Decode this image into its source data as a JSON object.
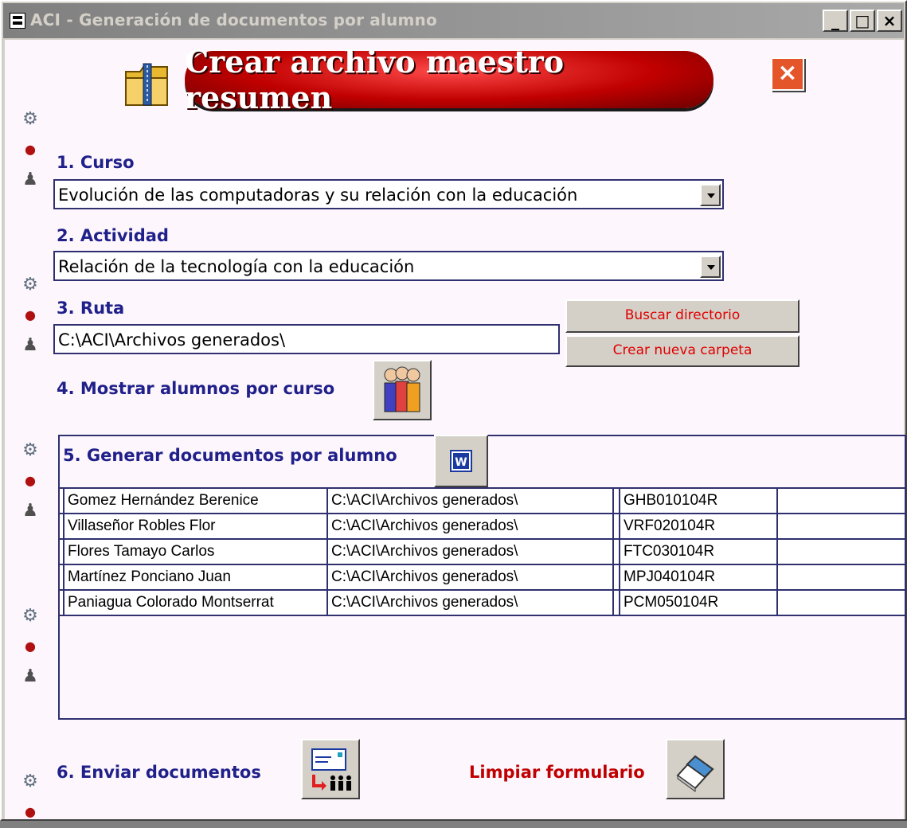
{
  "window": {
    "title": "ACI - Generación de documentos por alumno",
    "minimize": "_",
    "maximize": "□",
    "close": "×"
  },
  "header": {
    "banner_text": "Crear archivo maestro resumen",
    "close_glyph": "×"
  },
  "steps": {
    "curso_label": "1. Curso",
    "curso_value": "Evolución de las computadoras y su relación con la educación",
    "actividad_label": "2. Actividad",
    "actividad_value": "Relación de la tecnología con la educación",
    "ruta_label": "3. Ruta",
    "ruta_value": "C:\\ACI\\Archivos generados\\",
    "buscar_button": "Buscar directorio",
    "crear_button": "Crear nueva carpeta",
    "mostrar_label": "4. Mostrar alumnos por curso",
    "generar_label": "5. Generar documentos por alumno",
    "enviar_label": "6. Enviar documentos",
    "limpiar_label": "Limpiar formulario"
  },
  "students": [
    {
      "name": "Gomez Hernández Berenice",
      "path": "C:\\ACI\\Archivos generados\\",
      "code": "GHB010104R",
      "extra": ""
    },
    {
      "name": "Villaseñor Robles Flor",
      "path": "C:\\ACI\\Archivos generados\\",
      "code": "VRF020104R",
      "extra": ""
    },
    {
      "name": "Flores Tamayo Carlos",
      "path": "C:\\ACI\\Archivos generados\\",
      "code": "FTC030104R",
      "extra": ""
    },
    {
      "name": "Martínez Ponciano Juan",
      "path": "C:\\ACI\\Archivos generados\\",
      "code": "MPJ040104R",
      "extra": ""
    },
    {
      "name": "Paniagua Colorado Montserrat",
      "path": "C:\\ACI\\Archivos generados\\",
      "code": "PCM050104R",
      "extra": ""
    }
  ],
  "icons": {
    "title_icon": "form-icon",
    "header_icon": "zip-folder-icon",
    "mostrar_icon": "students-group-icon",
    "word_icon": "word-document-icon",
    "enviar_icon": "send-mail-icon",
    "limpiar_icon": "eraser-icon",
    "side_icons": [
      "tools-icon",
      "pushpin-icon",
      "robot-icon"
    ]
  },
  "colors": {
    "label_blue": "#20208a",
    "label_red": "#c00000",
    "button_text_red": "#e00000",
    "banner_red": "#c00000",
    "background": "#fdf6fc"
  }
}
